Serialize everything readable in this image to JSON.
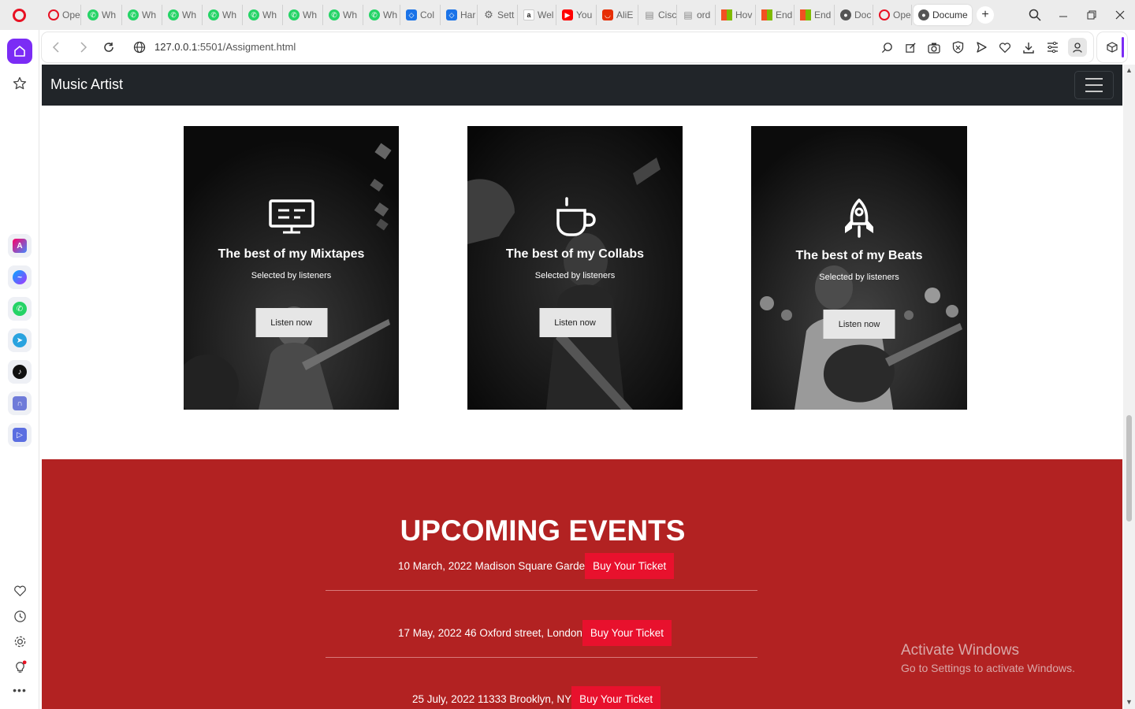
{
  "browser": {
    "tabs": [
      {
        "label": "Ope",
        "icon": "opera-icon",
        "color": "#e81123"
      },
      {
        "label": "Wh",
        "icon": "whatsapp-icon",
        "color": "#25d366"
      },
      {
        "label": "Wh",
        "icon": "whatsapp-icon",
        "color": "#25d366"
      },
      {
        "label": "Wh",
        "icon": "whatsapp-icon",
        "color": "#25d366"
      },
      {
        "label": "Wh",
        "icon": "whatsapp-icon",
        "color": "#25d366"
      },
      {
        "label": "Wh",
        "icon": "whatsapp-icon",
        "color": "#25d366"
      },
      {
        "label": "Wh",
        "icon": "whatsapp-icon",
        "color": "#25d366"
      },
      {
        "label": "Wh",
        "icon": "whatsapp-icon",
        "color": "#25d366"
      },
      {
        "label": "Wh",
        "icon": "whatsapp-icon",
        "color": "#25d366"
      },
      {
        "label": "Col",
        "icon": "colab-icon",
        "color": "#1a73e8"
      },
      {
        "label": "Har",
        "icon": "colab-icon",
        "color": "#1a73e8"
      },
      {
        "label": "Sett",
        "icon": "gear-icon",
        "color": "#666666"
      },
      {
        "label": "Wel",
        "icon": "amazon-icon",
        "color": "#222222"
      },
      {
        "label": "You",
        "icon": "youtube-icon",
        "color": "#ff0000"
      },
      {
        "label": "AliE",
        "icon": "aliexpress-icon",
        "color": "#e62e04"
      },
      {
        "label": "Cisc",
        "icon": "document-icon",
        "color": "#888888"
      },
      {
        "label": "ord",
        "icon": "document-icon",
        "color": "#888888"
      },
      {
        "label": "Hov",
        "icon": "microsoft-icon",
        "color": "#f25022"
      },
      {
        "label": "End",
        "icon": "microsoft-icon",
        "color": "#f25022"
      },
      {
        "label": "End",
        "icon": "microsoft-icon",
        "color": "#f25022"
      },
      {
        "label": "Doc",
        "icon": "globe-icon",
        "color": "#555555"
      },
      {
        "label": "Ope",
        "icon": "opera-icon",
        "color": "#e81123"
      }
    ],
    "active_tab": {
      "label": "Docume",
      "icon": "globe-icon"
    },
    "url_host": "127.0.0.1",
    "url_rest": ":5501/Assigment.html"
  },
  "page": {
    "brand": "Music Artist",
    "cards": [
      {
        "title": "The best of my Mixtapes",
        "subtitle": "Selected by listeners",
        "button": "Listen now",
        "icon": "monitor-icon"
      },
      {
        "title": "The best of my Collabs",
        "subtitle": "Selected by listeners",
        "button": "Listen now",
        "icon": "coffee-cup-icon"
      },
      {
        "title": "The best of my Beats",
        "subtitle": "Selected by listeners",
        "button": "Listen now",
        "icon": "rocket-icon"
      }
    ],
    "events": {
      "heading": "UPCOMING EVENTS",
      "items": [
        {
          "text": "10 March, 2022 Madison Square Garde",
          "button": "Buy Your Ticket"
        },
        {
          "text": "17 May, 2022 46 Oxford street, London",
          "button": "Buy Your Ticket"
        },
        {
          "text": "25 July, 2022 11333 Brooklyn, NY",
          "button": "Buy Your Ticket"
        }
      ]
    },
    "colors": {
      "navbar": "#212529",
      "events_bg": "#b22222",
      "ticket_button": "#e8112d"
    }
  },
  "watermark": {
    "line1": "Activate Windows",
    "line2": "Go to Settings to activate Windows."
  }
}
